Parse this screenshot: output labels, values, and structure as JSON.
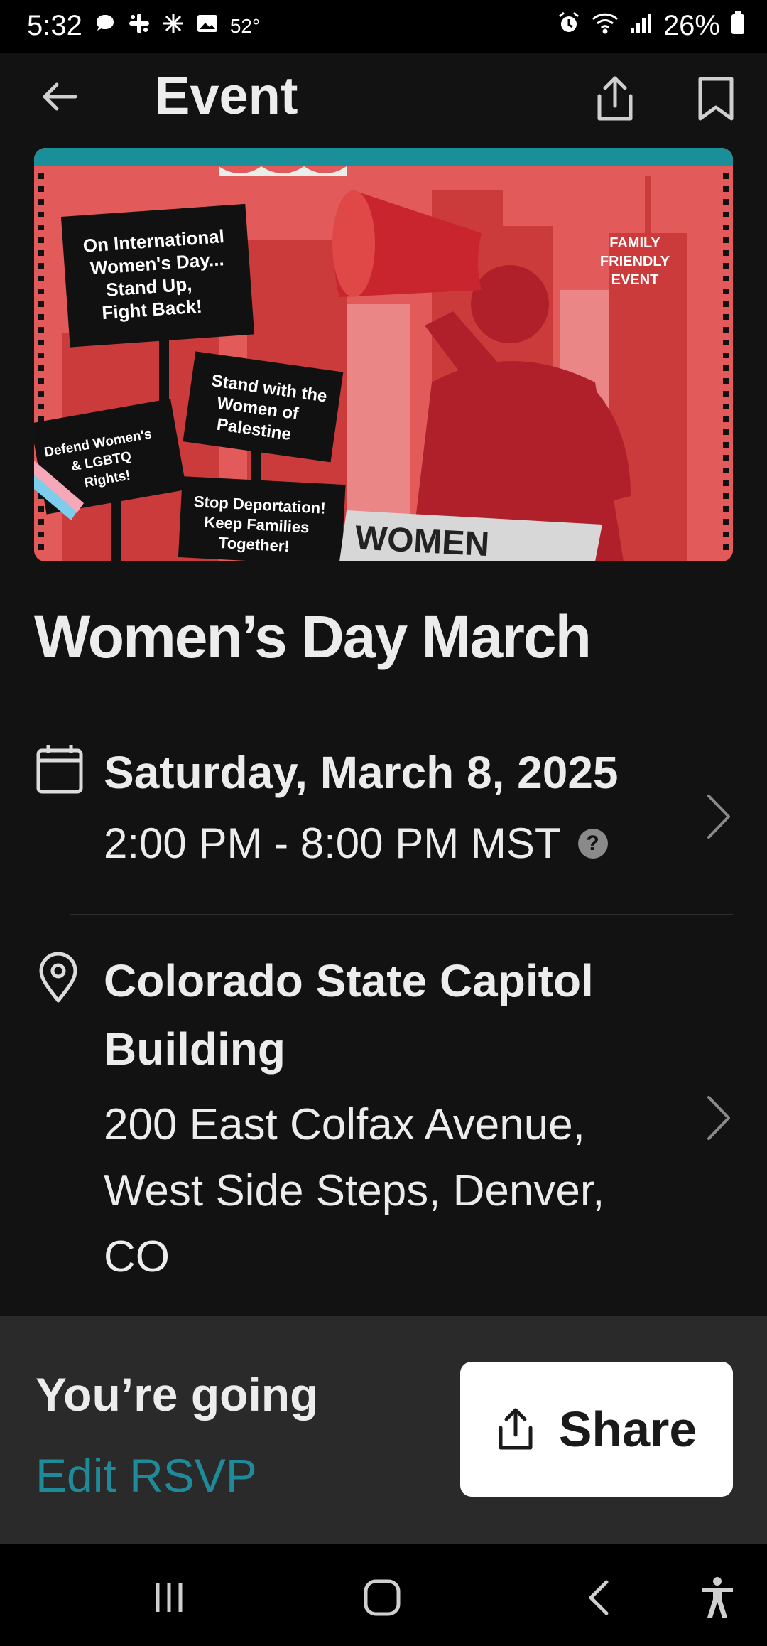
{
  "status_bar": {
    "time": "5:32",
    "temperature": "52°",
    "battery": "26%",
    "icons": [
      "chat-bubble-icon",
      "slack-icon",
      "sparkle-icon",
      "gallery-icon",
      "alarm-icon",
      "wifi-icon",
      "signal-icon",
      "battery-icon"
    ]
  },
  "app_bar": {
    "title": "Event",
    "icons": [
      "back-arrow-icon",
      "share-upload-icon",
      "bookmark-icon"
    ]
  },
  "hero": {
    "description_signs": [
      "On International Women's Day... Stand Up, Fight Back!",
      "Stand with the Women of Palestine",
      "Defend Women's & LGBTQ Rights!",
      "Stop Deportation! Keep Families Together!",
      "FAMILY FRIENDLY EVENT",
      "WOMEN"
    ]
  },
  "event": {
    "title": "Women’s Day March",
    "date": "Saturday, March 8, 2025",
    "time": "2:00 PM - 8:00 PM MST",
    "venue": "Colorado State Capitol Building",
    "address": "200 East Colfax Avenue, West Side Steps, Denver, CO"
  },
  "rsvp": {
    "status": "You’re going",
    "edit_label": "Edit RSVP",
    "share_label": "Share"
  },
  "colors": {
    "background": "#121212",
    "accent_teal": "#1f8a99",
    "panel": "#2a2a2a",
    "hero_red": "#e05050"
  }
}
